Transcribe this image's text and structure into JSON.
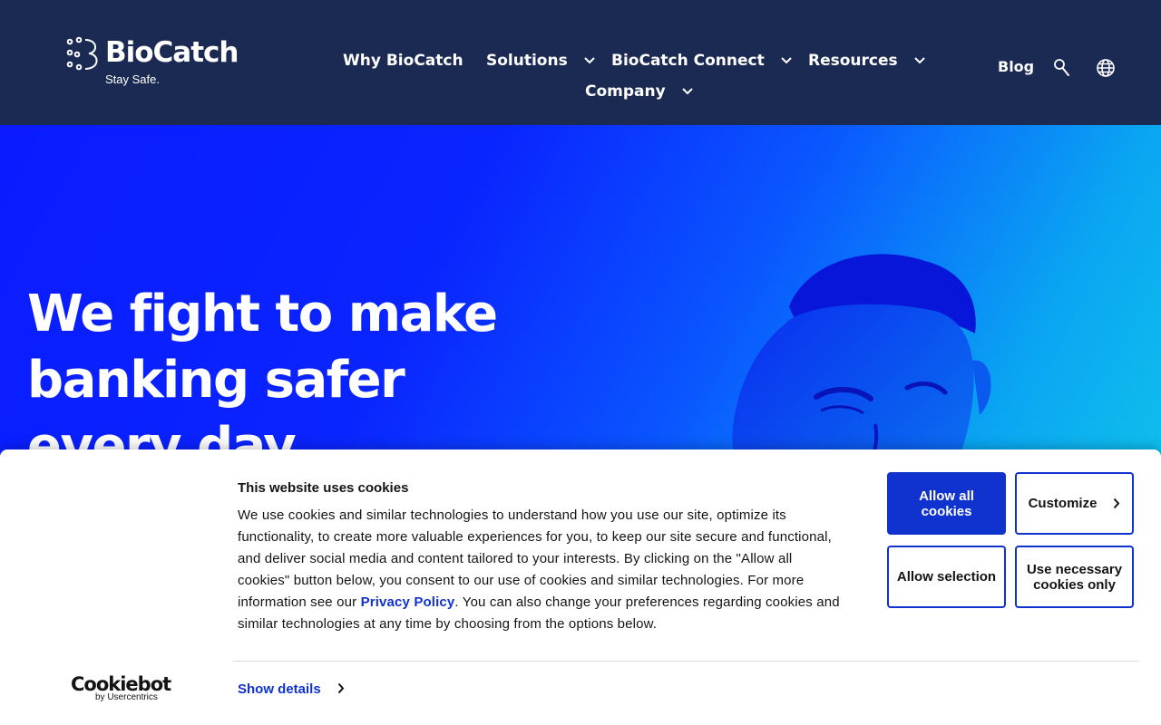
{
  "brand": {
    "name": "BioCatch",
    "tagline": "Stay Safe."
  },
  "nav": {
    "items": [
      {
        "label": "Why BioCatch",
        "has_dropdown": false
      },
      {
        "label": "Solutions",
        "has_dropdown": true
      },
      {
        "label": "BioCatch Connect",
        "has_dropdown": true
      },
      {
        "label": "Resources",
        "has_dropdown": true
      },
      {
        "label": "Company",
        "has_dropdown": true
      }
    ],
    "blog_label": "Blog",
    "icons": [
      "search-icon",
      "globe-icon"
    ]
  },
  "hero": {
    "title": "We fight to make banking safer every day"
  },
  "cookie_banner": {
    "title": "This website uses cookies",
    "body_before_link": "We use cookies and similar technologies to understand how you use our site, optimize its functionality, to create more valuable experiences for you, to keep our site secure and functional, and deliver social media and content tailored to your interests. By clicking on the \"Allow all cookies\" button below, you consent to our use of cookies and similar technologies. For more information see our ",
    "link_text": "Privacy Policy",
    "body_after_link": ". You can also change your preferences regarding cookies and similar technologies at any time by choosing from the options below.",
    "show_details": "Show details",
    "buttons": {
      "allow_all": "Allow all cookies",
      "customize": "Customize",
      "allow_selection": "Allow selection",
      "necessary_only": "Use necessary cookies only"
    },
    "provider_logo": {
      "word": "Cookiebot",
      "sub": "by Usercentrics"
    }
  },
  "colors": {
    "header_bg": "#1b2a52",
    "hero_gradient_start": "#0a1cff",
    "hero_gradient_end": "#13d0e8",
    "accent": "#1032cf",
    "text_dark": "#141414"
  }
}
